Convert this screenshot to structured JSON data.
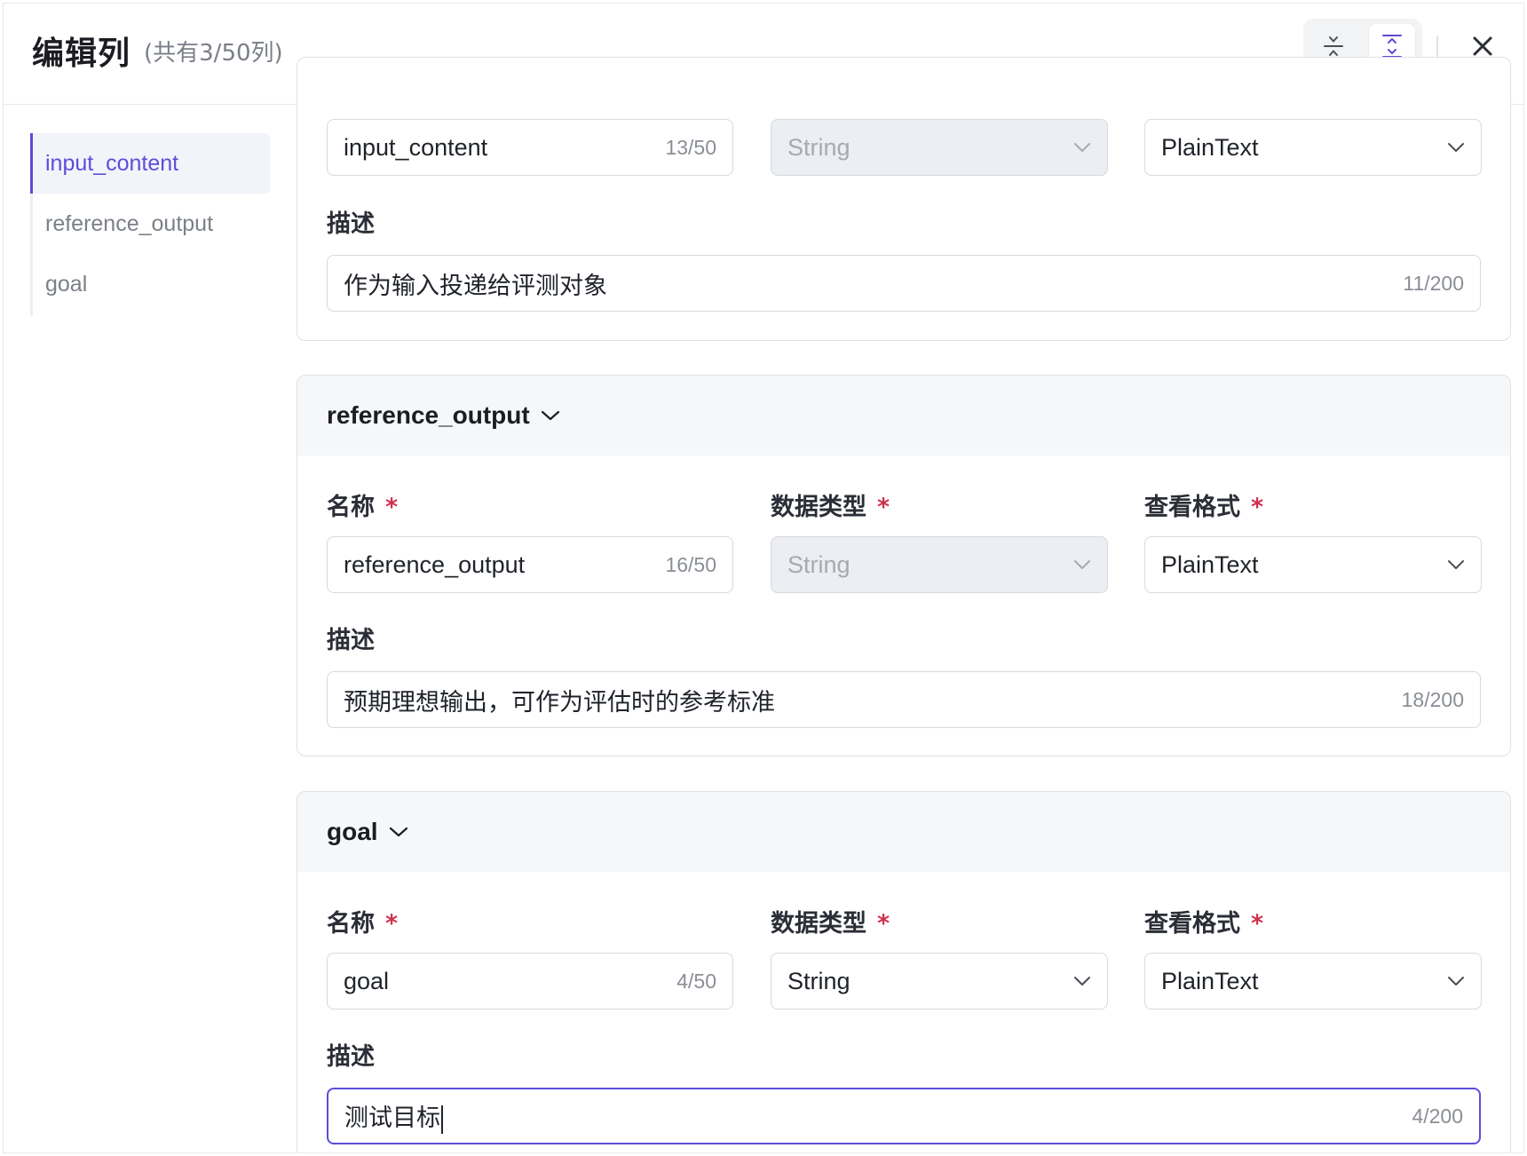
{
  "header": {
    "title": "编辑列",
    "subtitle": "(共有3/50列)",
    "collapse_all_icon": "collapse-all-icon",
    "expand_all_icon": "expand-all-icon",
    "close_icon": "close-icon"
  },
  "sidebar": {
    "items": [
      {
        "label": "input_content",
        "active": true
      },
      {
        "label": "reference_output",
        "active": false
      },
      {
        "label": "goal",
        "active": false
      }
    ]
  },
  "labels": {
    "name": "名称",
    "data_type": "数据类型",
    "view_format": "查看格式",
    "description": "描述",
    "required_mark": "*"
  },
  "columns": [
    {
      "header": "input_content",
      "name_value": "input_content",
      "name_count": "13/50",
      "data_type": "String",
      "data_type_disabled": true,
      "view_format": "PlainText",
      "description": "作为输入投递给评测对象",
      "description_count": "11/200"
    },
    {
      "header": "reference_output",
      "name_value": "reference_output",
      "name_count": "16/50",
      "data_type": "String",
      "data_type_disabled": true,
      "view_format": "PlainText",
      "description": "预期理想输出，可作为评估时的参考标准",
      "description_count": "18/200"
    },
    {
      "header": "goal",
      "name_value": "goal",
      "name_count": "4/50",
      "data_type": "String",
      "data_type_disabled": false,
      "view_format": "PlainText",
      "description": "测试目标",
      "description_count": "4/200",
      "description_focused": true
    }
  ],
  "colors": {
    "accent": "#5b4ddb",
    "required": "#d0304c",
    "disabled_bg": "#eceef3"
  }
}
